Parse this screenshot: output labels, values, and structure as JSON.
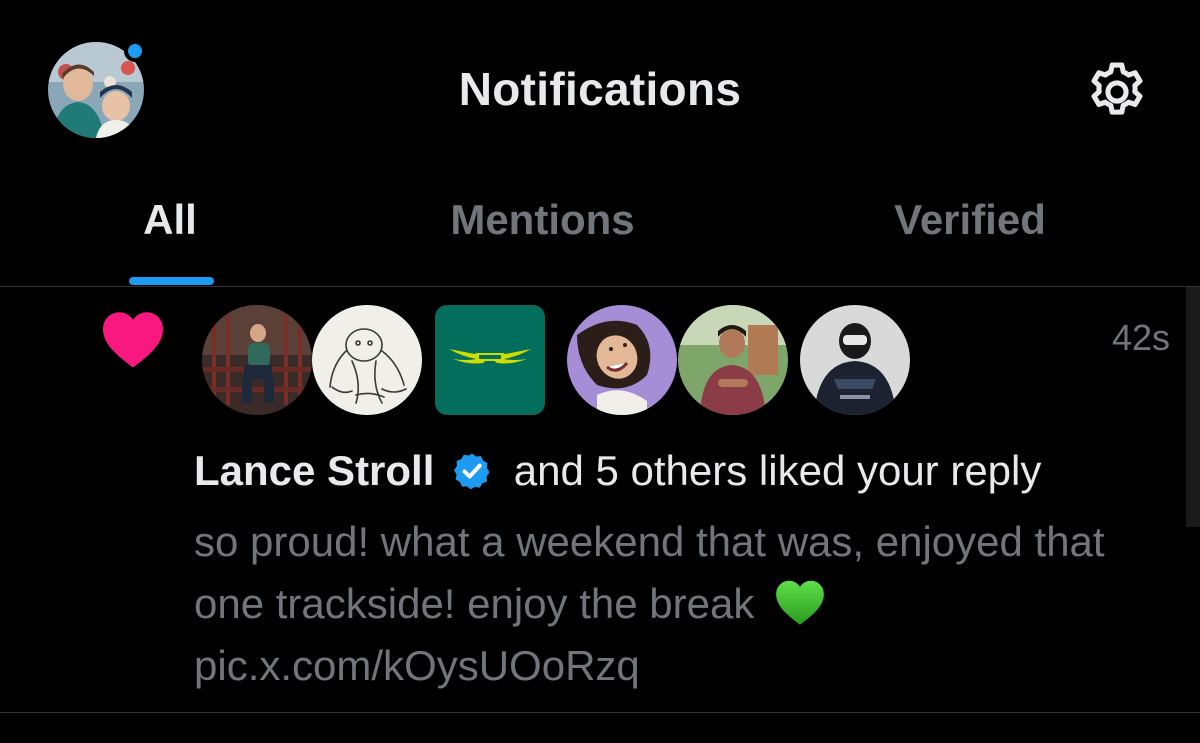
{
  "header": {
    "title": "Notifications",
    "avatar_icon": "profile-avatar",
    "settings_icon": "gear-icon",
    "unread_dot_color": "#1d9bf0"
  },
  "tabs": [
    {
      "label": "All",
      "active": true
    },
    {
      "label": "Mentions",
      "active": false
    },
    {
      "label": "Verified",
      "active": false
    }
  ],
  "accent_color": "#1d9bf0",
  "notification": {
    "type_icon": "heart-icon",
    "type_icon_color": "#f91880",
    "timestamp": "42s",
    "actor_name": "Lance Stroll",
    "verified_icon": "verified-badge-icon",
    "action_text": "and 5 others liked your reply",
    "reply_text": "so proud! what a weekend that was, enjoyed that one trackside! enjoy the break",
    "reply_emoji_icon": "green-heart-icon",
    "reply_link": "pic.x.com/kOysUOoRzq",
    "liker_avatars": [
      {
        "name": "avatar-lance-stroll",
        "shape": "circle"
      },
      {
        "name": "avatar-sketch",
        "shape": "circle"
      },
      {
        "name": "avatar-aston-martin",
        "shape": "square"
      },
      {
        "name": "avatar-user-purple",
        "shape": "circle"
      },
      {
        "name": "avatar-user-outdoor",
        "shape": "circle"
      },
      {
        "name": "avatar-driver-helmet",
        "shape": "circle"
      }
    ]
  }
}
